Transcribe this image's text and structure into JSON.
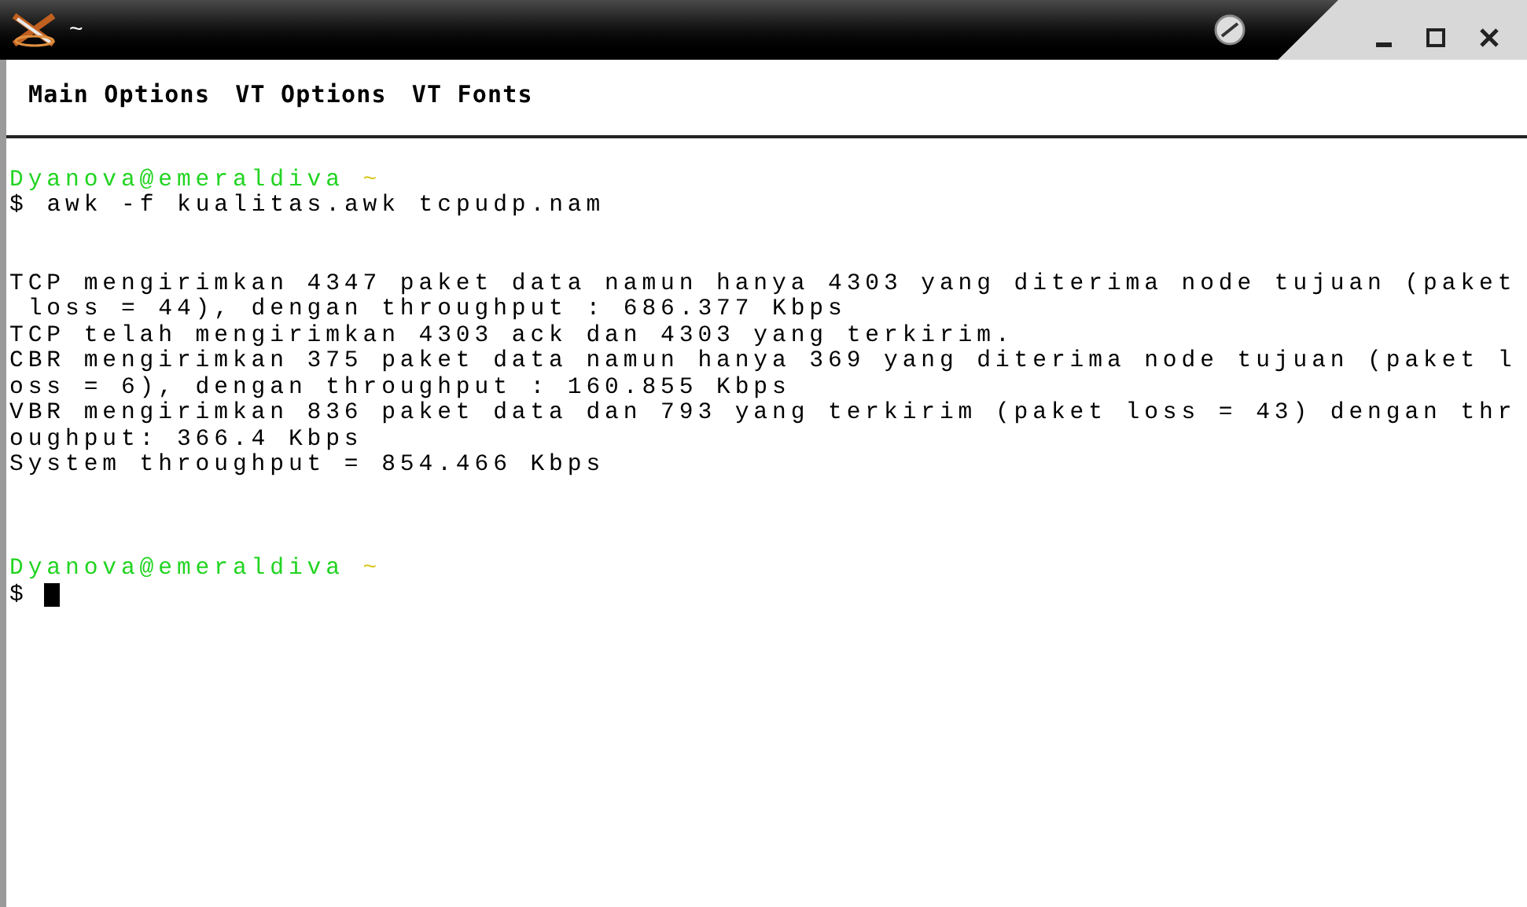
{
  "window": {
    "title": "~"
  },
  "menu": [
    "Main Options",
    "VT Options",
    "VT Fonts"
  ],
  "terminal": {
    "lines": [
      {
        "kind": "blank"
      },
      {
        "kind": "prompt",
        "user": "Dyanova@emeraldiva",
        "path": "~"
      },
      {
        "kind": "command",
        "symbol": "$",
        "text": "awk -f kualitas.awk tcpudp.nam"
      },
      {
        "kind": "blank"
      },
      {
        "kind": "blank"
      },
      {
        "kind": "output",
        "text": "TCP mengirimkan 4347 paket data namun hanya 4303 yang diterima node tujuan (paket"
      },
      {
        "kind": "output",
        "text": " loss = 44), dengan throughput : 686.377 Kbps"
      },
      {
        "kind": "output",
        "text": "TCP telah mengirimkan 4303 ack dan 4303 yang terkirim."
      },
      {
        "kind": "output",
        "text": "CBR mengirimkan 375 paket data namun hanya 369 yang diterima node tujuan (paket l"
      },
      {
        "kind": "output",
        "text": "oss = 6), dengan throughput : 160.855 Kbps"
      },
      {
        "kind": "output",
        "text": "VBR mengirimkan 836 paket data dan 793 yang terkirim (paket loss = 43) dengan thr"
      },
      {
        "kind": "output",
        "text": "oughput: 366.4 Kbps"
      },
      {
        "kind": "output",
        "text": "System throughput = 854.466 Kbps"
      },
      {
        "kind": "blank"
      },
      {
        "kind": "blank"
      },
      {
        "kind": "blank"
      },
      {
        "kind": "prompt",
        "user": "Dyanova@emeraldiva",
        "path": "~"
      },
      {
        "kind": "cursor",
        "symbol": "$"
      }
    ]
  }
}
